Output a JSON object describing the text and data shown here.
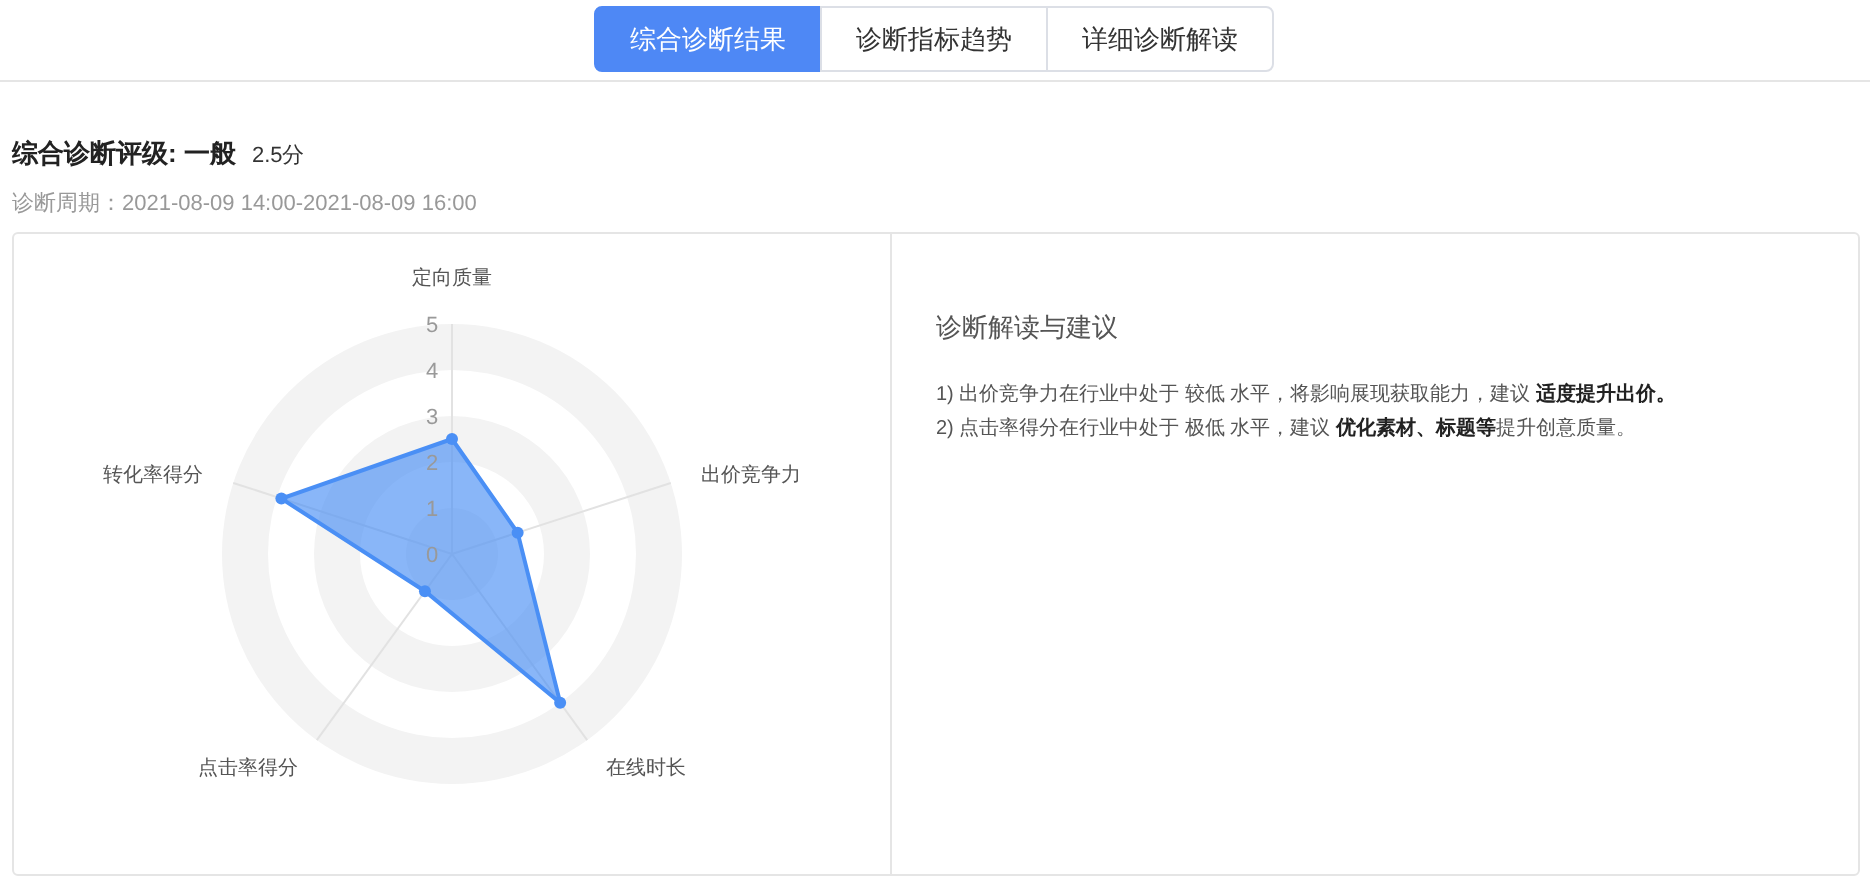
{
  "tabs": [
    {
      "label": "综合诊断结果",
      "selected": true
    },
    {
      "label": "诊断指标趋势",
      "selected": false
    },
    {
      "label": "详细诊断解读",
      "selected": false
    }
  ],
  "summary": {
    "title": "综合诊断评级: 一般",
    "score": "2.5分",
    "period": "诊断周期：2021-08-09 14:00-2021-08-09 16:00"
  },
  "chart_data": {
    "type": "radar",
    "categories": [
      "定向质量",
      "出价竞争力",
      "在线时长",
      "点击率得分",
      "转化率得分"
    ],
    "series": [
      {
        "color": "#4a8ff5",
        "values": [
          2.5,
          1.5,
          4,
          1,
          3.9
        ]
      }
    ],
    "ylim": [
      0,
      5
    ],
    "yticks": [
      0,
      1,
      2,
      3,
      4,
      5
    ]
  },
  "advice": {
    "title": "诊断解读与建议",
    "items": [
      "1) 出价竞争力在行业中处于 较低 水平，将影响展现获取能力，建议 **适度提升出价。**",
      "2) 点击率得分在行业中处于 极低 水平，建议 **优化素材、标题等**提升创意质量。"
    ]
  }
}
